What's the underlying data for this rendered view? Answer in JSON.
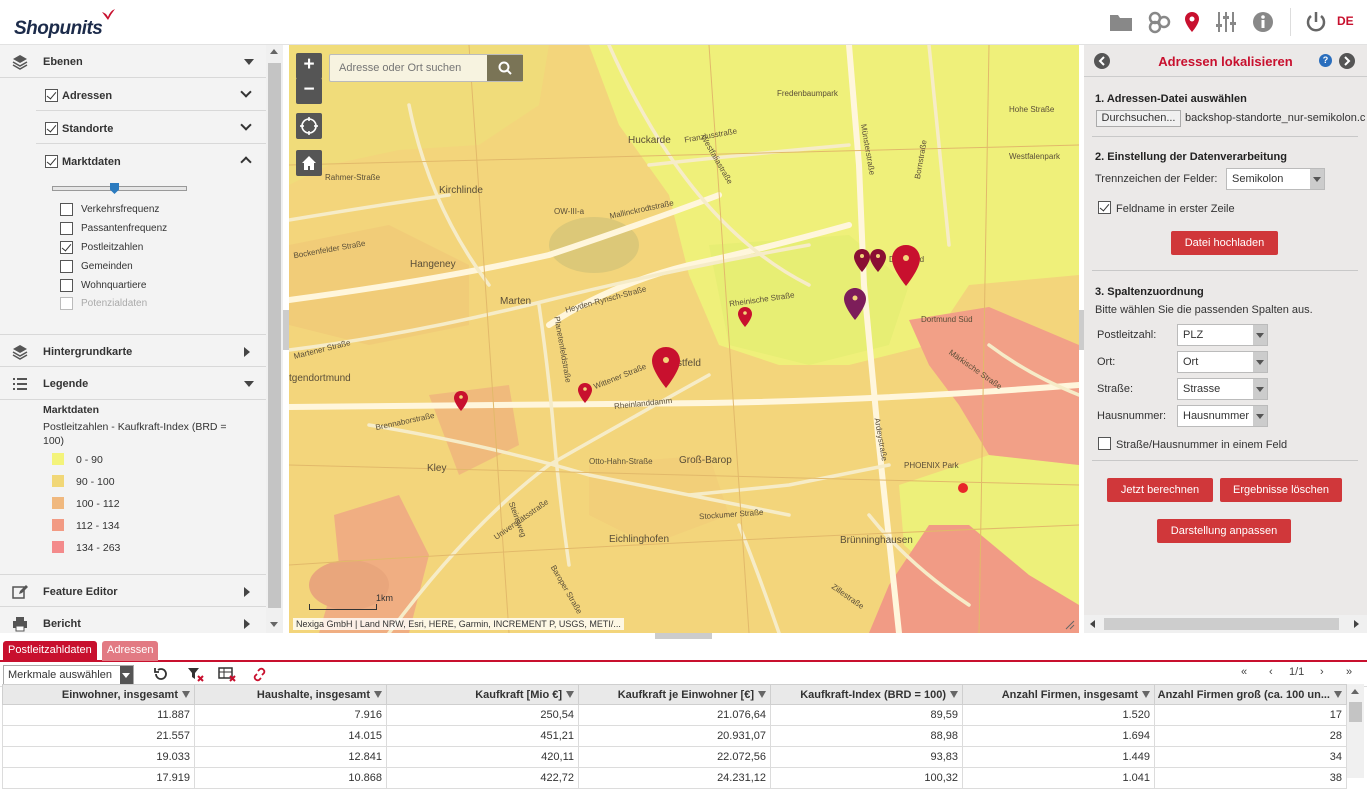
{
  "app": {
    "logo": "Shopunits",
    "lang": "DE"
  },
  "toolbar_icons": [
    "folder-icon",
    "hexagons-icon",
    "map-pin-icon",
    "sliders-icon",
    "info-icon",
    "power-icon"
  ],
  "sidebar": {
    "ebenen": "Ebenen",
    "layers": [
      {
        "label": "Adressen",
        "checked": true
      },
      {
        "label": "Standorte",
        "checked": true
      },
      {
        "label": "Marktdaten",
        "checked": true
      }
    ],
    "sublayers": [
      {
        "label": "Verkehrsfrequenz",
        "checked": false
      },
      {
        "label": "Passantenfrequenz",
        "checked": false
      },
      {
        "label": "Postleitzahlen",
        "checked": true
      },
      {
        "label": "Gemeinden",
        "checked": false
      },
      {
        "label": "Wohnquartiere",
        "checked": false
      },
      {
        "label": "Potenzialdaten",
        "checked": false,
        "disabled": true
      }
    ],
    "hintergrund": "Hintergrundkarte",
    "legende": "Legende",
    "legend_title": "Marktdaten",
    "legend_sub": "Postleitzahlen - Kaufkraft-Index (BRD = 100)",
    "legend_items": [
      {
        "label": "0 - 90",
        "color": "#f3f37a"
      },
      {
        "label": "90 - 100",
        "color": "#f1d777"
      },
      {
        "label": "100 - 112",
        "color": "#f0b87e"
      },
      {
        "label": "112 - 134",
        "color": "#f29a83"
      },
      {
        "label": "134 - 263",
        "color": "#f38a8b"
      }
    ],
    "feature_editor": "Feature Editor",
    "bericht": "Bericht"
  },
  "map": {
    "search_placeholder": "Adresse oder Ort suchen",
    "zoom_in": "+",
    "zoom_out": "−",
    "scale": "1km",
    "attribution": "Nexiga GmbH | Land NRW, Esri, HERE, Garmin, INCREMENT P, USGS, METI/...",
    "place_labels": [
      "Huckarde",
      "Kirchlinde",
      "Hangeney",
      "Marten",
      "Kley",
      "Groß-Barop",
      "Eichlinghofen",
      "Brünninghausen",
      "stfeld",
      "tgendortmund",
      "PHOENIX Park",
      "Dortmund Süd",
      "Fredenbaumpark",
      "Westfalenpark",
      "Dortmund"
    ],
    "street_labels": [
      "Rahmer-Straße",
      "OW-III-a",
      "Mallinckrodtstraße",
      "Heyden-Rynsch-Straße",
      "Rheinische Straße",
      "Wittener Straße",
      "Rheinlanddamm",
      "Brennaborstraße",
      "Stockumer Straße",
      "Universitätsstraße",
      "Märkische Straße",
      "Ardeystraße",
      "Zillestraße",
      "Westfaliastraße",
      "Münsterstraße",
      "Bornstraße",
      "Franziusstraße",
      "Bockenfelder Straße",
      "Martener Straße",
      "Planetenfeldstraße",
      "Steinsweg",
      "Otto-Hahn-Straße",
      "Baroper Straße",
      "Hohe Straße"
    ]
  },
  "panel": {
    "title": "Adressen lokalisieren",
    "s1": "1. Adressen-Datei auswählen",
    "browse": "Durchsuchen...",
    "filename": "backshop-standorte_nur-semikolon.csv",
    "s2": "2. Einstellung der Datenverarbeitung",
    "sep_label": "Trennzeichen der Felder:",
    "sep_value": "Semikolon",
    "header_cb": "Feldname in erster Zeile",
    "upload": "Datei hochladen",
    "s3": "3. Spaltenzuordnung",
    "s3_hint": "Bitte wählen Sie die passenden Spalten aus.",
    "fields": [
      {
        "label": "Postleitzahl:",
        "value": "PLZ"
      },
      {
        "label": "Ort:",
        "value": "Ort"
      },
      {
        "label": "Straße:",
        "value": "Strasse"
      },
      {
        "label": "Hausnummer:",
        "value": "Hausnummer"
      }
    ],
    "combined_cb": "Straße/Hausnummer in einem Feld",
    "btn_calc": "Jetzt berechnen",
    "btn_clear": "Ergebnisse löschen",
    "btn_adjust": "Darstellung anpassen"
  },
  "bottom": {
    "tabs": [
      "Postleitzahldaten",
      "Adressen"
    ],
    "merkmale": "Merkmale auswählen",
    "pager": "1/1",
    "columns": [
      "Einwohner, insgesamt",
      "Haushalte, insgesamt",
      "Kaufkraft [Mio €]",
      "Kaufkraft je Einwohner [€]",
      "Kaufkraft-Index (BRD = 100)",
      "Anzahl Firmen, insgesamt",
      "Anzahl Firmen groß (ca. 100 un..."
    ],
    "rows": [
      [
        "11.887",
        "7.916",
        "250,54",
        "21.076,64",
        "89,59",
        "1.520",
        "17"
      ],
      [
        "21.557",
        "14.015",
        "451,21",
        "20.931,07",
        "88,98",
        "1.694",
        "28"
      ],
      [
        "19.033",
        "12.841",
        "420,11",
        "22.072,56",
        "93,83",
        "1.449",
        "34"
      ],
      [
        "17.919",
        "10.868",
        "422,72",
        "24.231,12",
        "100,32",
        "1.041",
        "38"
      ]
    ]
  }
}
